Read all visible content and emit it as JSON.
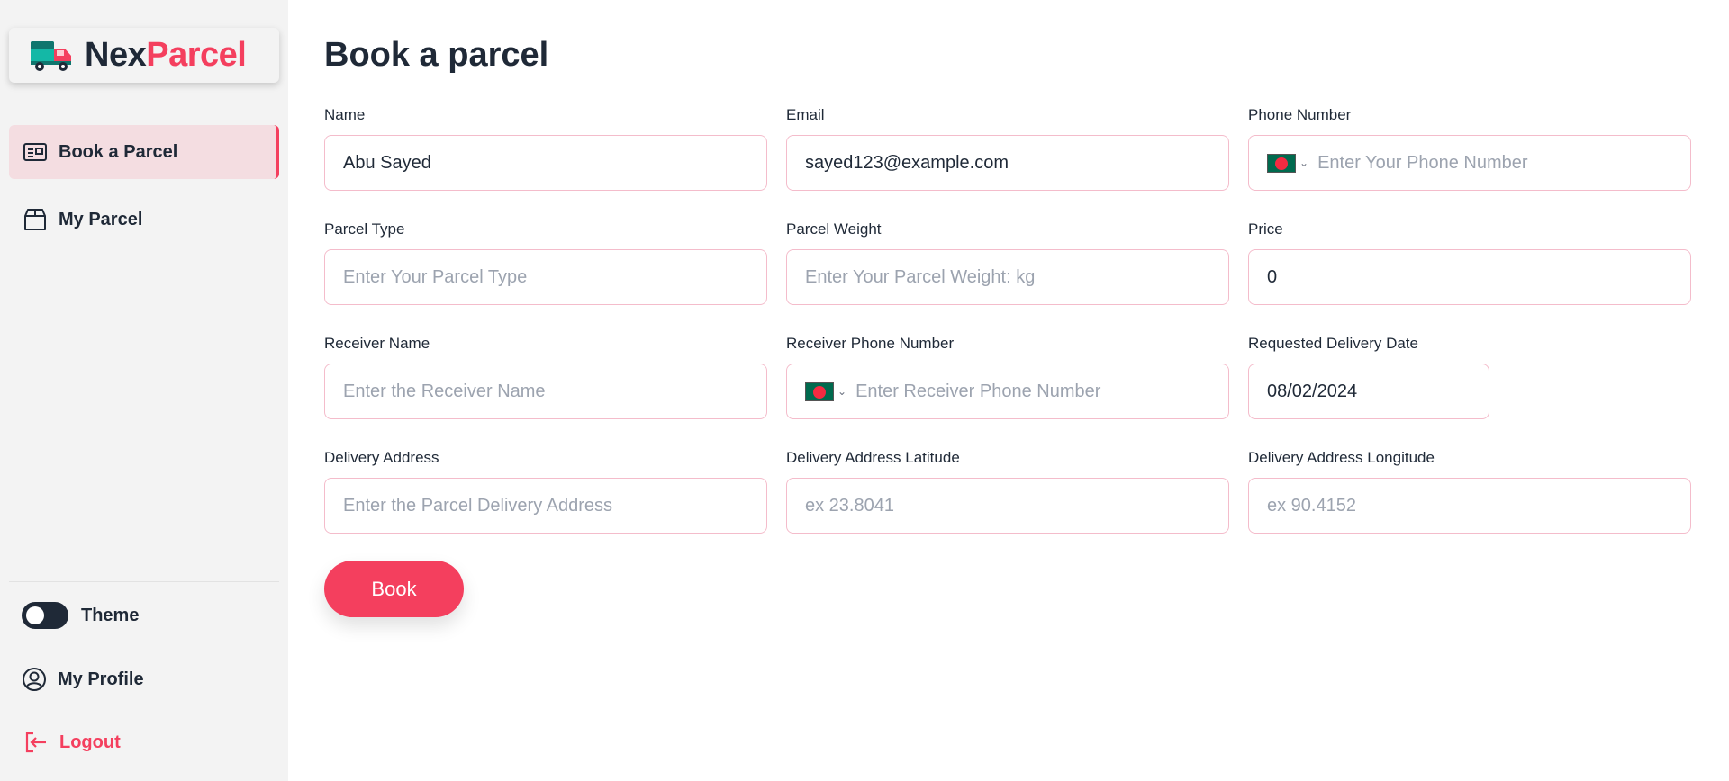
{
  "brand": {
    "part1": "Nex",
    "part2": "Parcel"
  },
  "sidebar": {
    "nav": [
      {
        "label": "Book a Parcel",
        "icon": "id-card-icon",
        "active": true
      },
      {
        "label": "My Parcel",
        "icon": "box-icon",
        "active": false
      }
    ],
    "theme_label": "Theme",
    "profile_label": "My Profile",
    "logout_label": "Logout"
  },
  "page": {
    "title": "Book a parcel"
  },
  "form": {
    "name": {
      "label": "Name",
      "value": "Abu Sayed",
      "placeholder": ""
    },
    "email": {
      "label": "Email",
      "value": "sayed123@example.com",
      "placeholder": ""
    },
    "phone": {
      "label": "Phone Number",
      "value": "",
      "placeholder": "Enter Your Phone Number"
    },
    "parcel_type": {
      "label": "Parcel Type",
      "value": "",
      "placeholder": "Enter Your Parcel Type"
    },
    "parcel_weight": {
      "label": "Parcel Weight",
      "value": "",
      "placeholder": "Enter Your Parcel Weight: kg"
    },
    "price": {
      "label": "Price",
      "value": "0",
      "placeholder": ""
    },
    "receiver_name": {
      "label": "Receiver Name",
      "value": "",
      "placeholder": "Enter the Receiver Name"
    },
    "receiver_phone": {
      "label": "Receiver Phone Number",
      "value": "",
      "placeholder": "Enter Receiver Phone Number"
    },
    "delivery_date": {
      "label": "Requested Delivery Date",
      "value": "08/02/2024"
    },
    "delivery_address": {
      "label": "Delivery Address",
      "value": "",
      "placeholder": "Enter the Parcel Delivery Address"
    },
    "latitude": {
      "label": "Delivery Address Latitude",
      "value": "",
      "placeholder": "ex 23.8041"
    },
    "longitude": {
      "label": "Delivery Address Longitude",
      "value": "",
      "placeholder": "ex 90.4152"
    },
    "submit_label": "Book"
  },
  "colors": {
    "accent": "#f43f5e",
    "sidebar_bg": "#f3f3f3",
    "active_bg": "#f4dde1",
    "input_border": "#f4bccb"
  }
}
